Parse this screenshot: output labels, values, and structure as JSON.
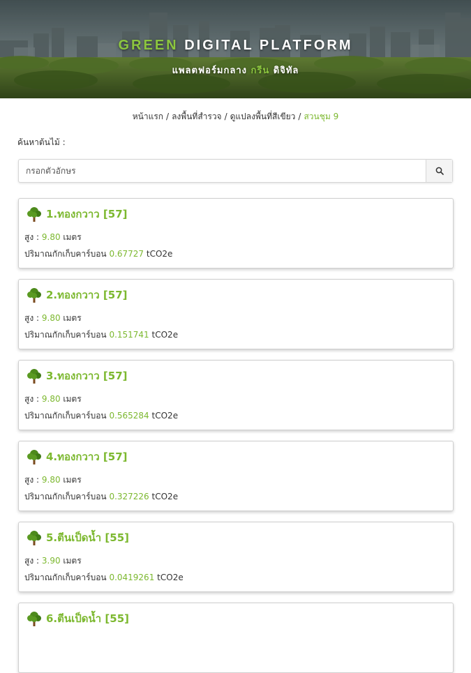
{
  "header": {
    "title_green": "GREEN",
    "title_rest": "DIGITAL PLATFORM",
    "subtitle_pre": "แพลตฟอร์มกลาง",
    "subtitle_green": "กรีน",
    "subtitle_post": "ดิจิทัล"
  },
  "breadcrumb": {
    "items": [
      "หน้าแรก",
      "ลงพื้นที่สำรวจ",
      "ดูแปลงพื้นที่สีเขียว"
    ],
    "separator": "/",
    "active": "สวนชุม 9"
  },
  "search": {
    "label": "ค้นหาต้นไม้ :",
    "placeholder": "กรอกตัวอักษร",
    "value": ""
  },
  "labels": {
    "height_label": "สูง :",
    "height_unit": "เมตร",
    "carbon_label": "ปริมาณกักเก็บคาร์บอน",
    "carbon_unit": "tCO2e"
  },
  "trees": [
    {
      "title": "1.ทองกวาว [57]",
      "height": "9.80",
      "carbon": "0.67727"
    },
    {
      "title": "2.ทองกวาว [57]",
      "height": "9.80",
      "carbon": "0.151741"
    },
    {
      "title": "3.ทองกวาว [57]",
      "height": "9.80",
      "carbon": "0.565284"
    },
    {
      "title": "4.ทองกวาว [57]",
      "height": "9.80",
      "carbon": "0.327226"
    },
    {
      "title": "5.ตีนเป็ดน้ำ [55]",
      "height": "3.90",
      "carbon": "0.0419261"
    },
    {
      "title": "6.ตีนเป็ดน้ำ [55]",
      "height": "",
      "carbon": ""
    }
  ],
  "colors": {
    "accent": "#7cb82f",
    "hero_green": "#8cc63f"
  },
  "icons": {
    "tree": "tree-icon",
    "search": "search-icon"
  }
}
